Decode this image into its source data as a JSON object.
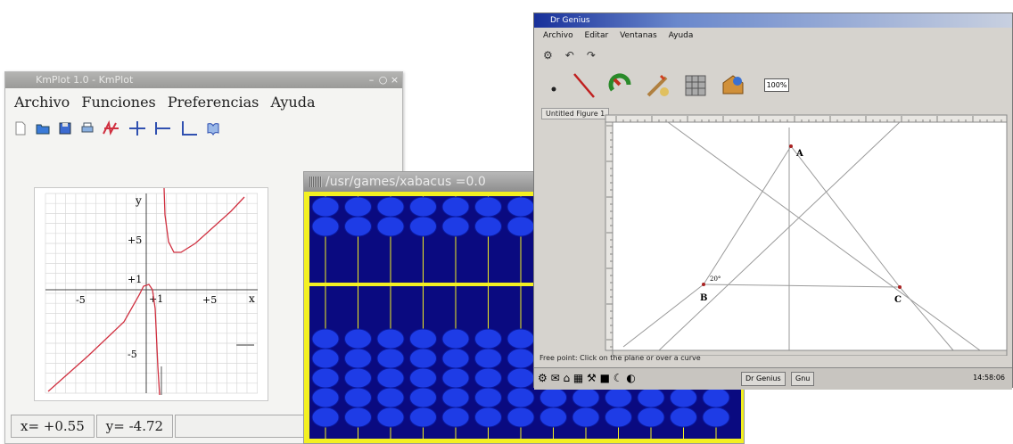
{
  "kmplot": {
    "title": "KmPlot 1.0 - KmPlot",
    "menu": [
      "Archivo",
      "Funciones",
      "Preferencias",
      "Ayuda"
    ],
    "toolbar_icons": [
      "new-file-icon",
      "open-folder-icon",
      "save-icon",
      "print-icon",
      "plot-function-icon",
      "grid-cross-icon",
      "axes-t-icon",
      "axes-l-icon",
      "help-book-icon"
    ],
    "axis": {
      "x_label": "x",
      "y_label": "y",
      "x_ticks": [
        "-5",
        "+1",
        "+5"
      ],
      "y_ticks": [
        "+5",
        "+1",
        "-5"
      ]
    },
    "status": {
      "x": "x= +0.55",
      "y": "y= -4.72"
    },
    "colors": {
      "curve": "#d03040",
      "grid": "#d8d8d8"
    }
  },
  "xabacus": {
    "title": "/usr/games/xabacus =0.0",
    "columns": 13,
    "colors": {
      "frame": "#f3f021",
      "board": "#0a0a80",
      "bead": "#1e3ce6",
      "rod": "#f3f021"
    }
  },
  "drgeo": {
    "title": "Dr Genius",
    "menu": [
      "Archivo",
      "Editar",
      "Ventanas",
      "Ayuda"
    ],
    "zoom": "100%",
    "doc_tab": "Untitled Figure 1",
    "points": {
      "A": "A",
      "B": "B",
      "C": "C",
      "angle_label": "20°"
    },
    "status_line": "Free point: Click on the plane or over a curve",
    "taskbar": {
      "task1": "Dr Genius",
      "task2": "Gnu",
      "clock": "14:58:06"
    },
    "toolbar_icons": [
      "undo-icon",
      "redo-icon",
      "point-icon",
      "line-icon",
      "transform-icon",
      "macro-icon",
      "numeric-icon",
      "other-icon"
    ]
  }
}
